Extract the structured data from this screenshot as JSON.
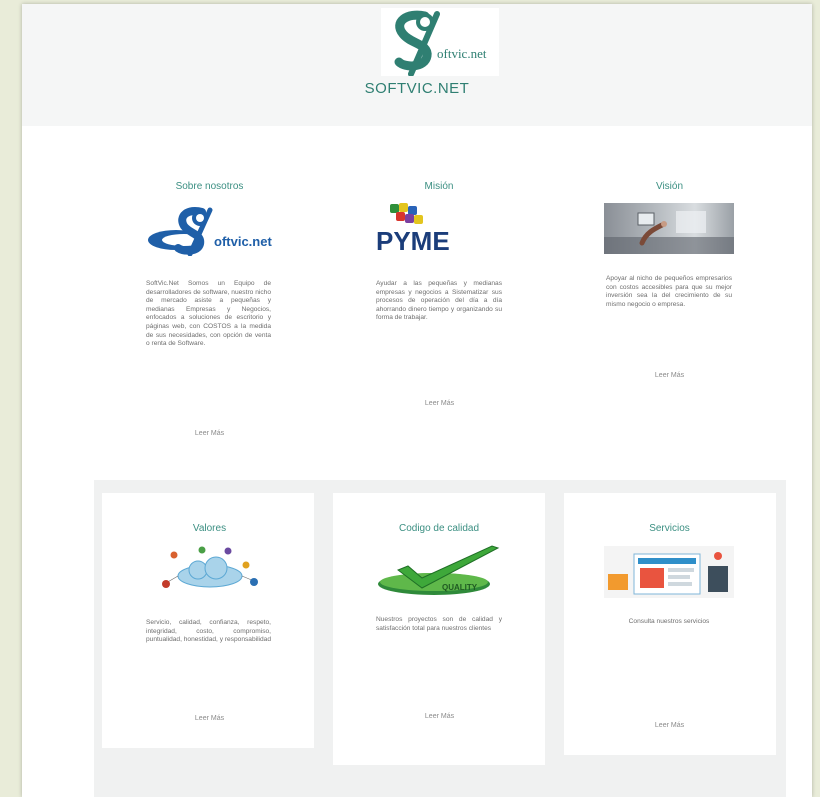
{
  "header": {
    "logo_text": "oftvic.net",
    "site_title": "SOFTVIC.NET"
  },
  "cards": [
    {
      "title": "Sobre nosotros",
      "image": "softvic-logo",
      "logo_text": "oftvic.net",
      "text": "SoftVic.Net Somos un Equipo de desarrolladores de software, nuestro nicho de mercado asiste a pequeñas y medianas Empresas y Negocios, enfocados a soluciones de escritorio y páginas web, con COSTOS a la medida de sus necesidades, con opción de venta o renta de Software.",
      "link": "Leer Más"
    },
    {
      "title": "Misión",
      "image": "pyme-puzzle-logo",
      "logo_text": "PYME",
      "text": "Ayudar a las pequeñas y medianas empresas y negocios a Sistematizar sus procesos de operación del día a día ahorrando dinero tiempo y organizando su forma de trabajar.",
      "link": "Leer Más"
    },
    {
      "title": "Visión",
      "image": "touchscreen-photo",
      "text": "Apoyar al nicho de pequeños empresarios con costos accesibles para que su mejor inversión sea la del crecimiento de su mismo negocio o empresa.",
      "link": "Leer Más"
    },
    {
      "title": "Valores",
      "image": "cloud-network-illustration",
      "text": "Servicio, calidad, confianza, respeto, integridad, costo, compromiso, puntualidad, honestidad, y responsabilidad",
      "link": "Leer Más"
    },
    {
      "title": "Codigo de calidad",
      "image": "quality-checkmark",
      "badge_text": "QUALITY",
      "text": "Nuestros proyectos son de calidad y satisfacción total para nuestros clientes",
      "link": "Leer Más"
    },
    {
      "title": "Servicios",
      "image": "web-design-illustration",
      "text": "Consulta nuestros servicios",
      "link": "Leer Más"
    }
  ],
  "colors": {
    "brand_teal": "#2f7f72",
    "logo_blue": "#1f5fa8",
    "pyme_blue": "#1b3d7a"
  }
}
